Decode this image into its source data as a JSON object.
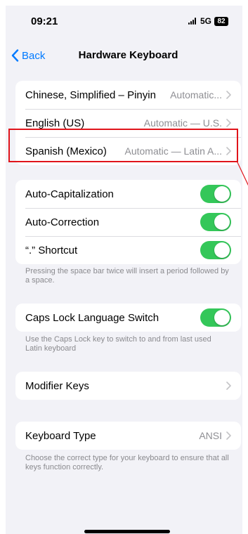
{
  "status_bar": {
    "time": "09:21",
    "network": "5G",
    "battery": "82"
  },
  "nav": {
    "back_label": "Back",
    "title": "Hardware Keyboard"
  },
  "keyboards": [
    {
      "label": "Chinese, Simplified – Pinyin",
      "value": "Automatic..."
    },
    {
      "label": "English (US)",
      "value": "Automatic — U.S."
    },
    {
      "label": "Spanish (Mexico)",
      "value": "Automatic — Latin A..."
    }
  ],
  "typing": {
    "items": [
      {
        "label": "Auto-Capitalization",
        "on": true
      },
      {
        "label": "Auto-Correction",
        "on": true
      },
      {
        "label": "“.” Shortcut",
        "on": true
      }
    ],
    "footer": "Pressing the space bar twice will insert a period followed by a space."
  },
  "caps_lock": {
    "label": "Caps Lock Language Switch",
    "on": true,
    "footer": "Use the Caps Lock key to switch to and from last used Latin keyboard"
  },
  "modifier": {
    "label": "Modifier Keys"
  },
  "keyboard_type": {
    "label": "Keyboard Type",
    "value": "ANSI",
    "footer": "Choose the correct type for your keyboard to ensure that all keys function correctly."
  },
  "colors": {
    "accent": "#007aff",
    "toggle_on": "#34c759",
    "highlight": "#e0141b"
  }
}
